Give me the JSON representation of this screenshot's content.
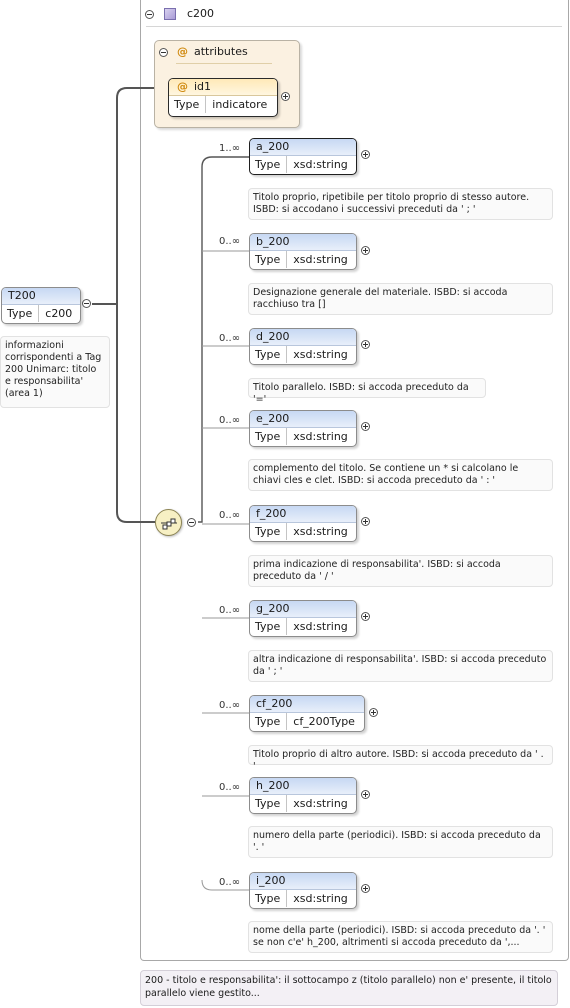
{
  "container": {
    "name": "c200",
    "icon": "complex-type-icon"
  },
  "attributes": {
    "label": "attributes",
    "icon": "at-icon",
    "items": [
      {
        "name": "id1",
        "type_key": "Type",
        "type_value": "indicatore"
      }
    ]
  },
  "root": {
    "name": "T200",
    "type_key": "Type",
    "type_value": "c200",
    "doc": "informazioni corrispondenti a Tag 200 Unimarc: titolo e responsabilita' (area 1)"
  },
  "sequence": {
    "icon": "sequence-compositor-icon"
  },
  "elements": [
    {
      "name": "a_200",
      "cardinality": "1..∞",
      "type_key": "Type",
      "type_value": "xsd:string",
      "doc": "Titolo proprio, ripetibile per titolo proprio di stesso autore. ISBD: si accodano i successivi preceduti da ' ; '"
    },
    {
      "name": "b_200",
      "cardinality": "0..∞",
      "type_key": "Type",
      "type_value": "xsd:string",
      "doc": "Designazione generale del materiale. ISBD: si accoda racchiuso tra []"
    },
    {
      "name": "d_200",
      "cardinality": "0..∞",
      "type_key": "Type",
      "type_value": "xsd:string",
      "doc": "Titolo parallelo. ISBD: si accoda preceduto da '='"
    },
    {
      "name": "e_200",
      "cardinality": "0..∞",
      "type_key": "Type",
      "type_value": "xsd:string",
      "doc": "complemento del titolo. Se contiene un * si calcolano le chiavi cles e clet. ISBD: si accoda preceduto da ' : '"
    },
    {
      "name": "f_200",
      "cardinality": "0..∞",
      "type_key": "Type",
      "type_value": "xsd:string",
      "doc": "prima indicazione di responsabilita'. ISBD: si accoda preceduto da ' / '"
    },
    {
      "name": "g_200",
      "cardinality": "0..∞",
      "type_key": "Type",
      "type_value": "xsd:string",
      "doc": "altra indicazione di responsabilita'. ISBD: si accoda preceduto da ' ; '"
    },
    {
      "name": "cf_200",
      "cardinality": "0..∞",
      "type_key": "Type",
      "type_value": "cf_200Type",
      "doc": "Titolo proprio di altro autore. ISBD: si accoda preceduto da ' . '"
    },
    {
      "name": "h_200",
      "cardinality": "0..∞",
      "type_key": "Type",
      "type_value": "xsd:string",
      "doc": "numero della parte (periodici). ISBD: si accoda preceduto da '. '"
    },
    {
      "name": "i_200",
      "cardinality": "0..∞",
      "type_key": "Type",
      "type_value": "xsd:string",
      "doc": "nome della parte (periodici). ISBD: si accoda preceduto da '. ' se non c'e' h_200, altrimenti si accoda preceduto da ',..."
    }
  ],
  "footer_note": "200 - titolo e responsabilita': il sottocampo z (titolo parallelo) non e' presente, il titolo parallelo viene gestito..."
}
